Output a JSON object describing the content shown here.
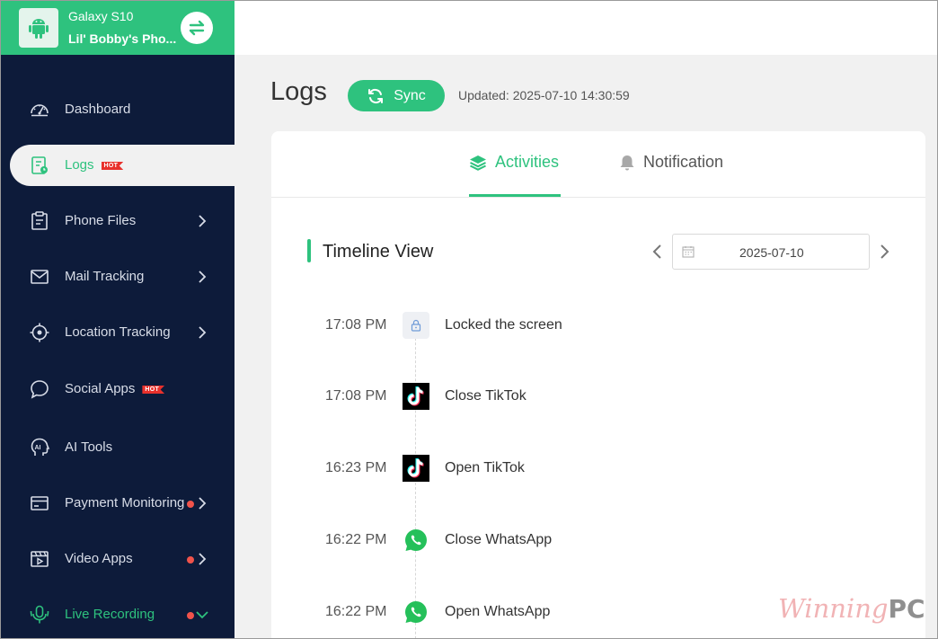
{
  "device": {
    "model": "Galaxy S10",
    "name": "Lil' Bobby's Pho..."
  },
  "sidebar": {
    "items": [
      {
        "label": "Dashboard",
        "icon": "gauge-icon"
      },
      {
        "label": "Logs",
        "icon": "log-file-icon",
        "badge": "HOT",
        "active": true
      },
      {
        "label": "Phone Files",
        "icon": "clipboard-icon"
      },
      {
        "label": "Mail Tracking",
        "icon": "mail-icon"
      },
      {
        "label": "Location Tracking",
        "icon": "location-target-icon"
      },
      {
        "label": "Social Apps",
        "icon": "chat-bubble-icon",
        "badge": "HOT"
      },
      {
        "label": "AI Tools",
        "icon": "ai-head-icon"
      },
      {
        "label": "Payment Monitoring",
        "icon": "card-icon"
      },
      {
        "label": "Video Apps",
        "icon": "video-icon"
      },
      {
        "label": "Live Recording",
        "icon": "microphone-icon"
      }
    ]
  },
  "header": {
    "title": "Logs",
    "sync_label": "Sync",
    "updated": "Updated: 2025-07-10 14:30:59"
  },
  "tabs": {
    "activities": "Activities",
    "notification": "Notification"
  },
  "timeline": {
    "title": "Timeline View",
    "date": "2025-07-10",
    "events": [
      {
        "time": "17:08 PM",
        "icon": "lock-icon",
        "text": "Locked the screen"
      },
      {
        "time": "17:08 PM",
        "icon": "tiktok-icon",
        "text": "Close TikTok"
      },
      {
        "time": "16:23 PM",
        "icon": "tiktok-icon",
        "text": "Open TikTok"
      },
      {
        "time": "16:22 PM",
        "icon": "whatsapp-icon",
        "text": "Close WhatsApp"
      },
      {
        "time": "16:22 PM",
        "icon": "whatsapp-icon",
        "text": "Open WhatsApp"
      }
    ]
  },
  "watermark": {
    "part1": "Winning",
    "part2": "PC"
  },
  "colors": {
    "accent": "#2ec27e",
    "sidebar_bg": "#0d1b3a",
    "hot_badge": "#e8312c",
    "dot": "#f0534b"
  }
}
